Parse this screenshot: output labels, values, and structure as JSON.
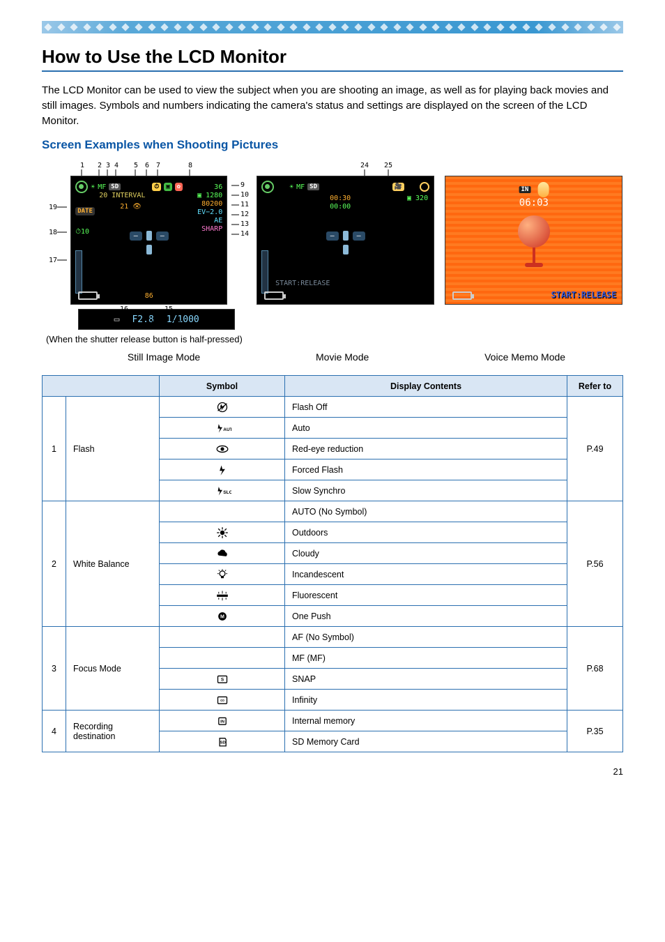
{
  "page_number": "21",
  "title": "How to Use the LCD Monitor",
  "intro": "The LCD Monitor can be used to view the subject when you are shooting an image, as well as for playing back movies and still images. Symbols and numbers indicating the camera's status and settings are displayed on the screen of the LCD Monitor.",
  "subheading": "Screen Examples when Shooting Pictures",
  "shutter_caption": "(When the shutter release button is half-pressed)",
  "mode_labels": {
    "still": "Still Image Mode",
    "movie": "Movie Mode",
    "voice": "Voice Memo Mode"
  },
  "still_lcd": {
    "remaining": "36",
    "interval_label": "INTERVAL",
    "interval_n": "20",
    "date_label": "DATE",
    "s10": "10",
    "right_stack": [
      "1280",
      "80200",
      "EV−2.0",
      "AE",
      "SHARP"
    ],
    "bottom_num": "86",
    "balloon21": "21",
    "aperture": "F2.8",
    "shutter": "1/1000"
  },
  "movie_lcd": {
    "time_top": "00:30",
    "time_bot": "00:00",
    "size": "320",
    "start": "START:RELEASE"
  },
  "voice_lcd": {
    "time": "06:03",
    "start": "START:RELEASE",
    "in": "IN"
  },
  "table": {
    "headers": {
      "symbol": "Symbol",
      "contents": "Display Contents",
      "refer": "Refer to"
    },
    "rows": [
      {
        "num": "1",
        "label": "Flash",
        "cells": [
          {
            "icon": "flash-off",
            "text": "Flash Off",
            "ref": "P.49"
          },
          {
            "icon": "flash-auto",
            "text": "Auto",
            "ref": ""
          },
          {
            "icon": "redeye",
            "text": "Red-eye reduction",
            "ref": ""
          },
          {
            "icon": "flash-forced",
            "text": "Forced Flash",
            "ref": ""
          },
          {
            "icon": "flash-slow",
            "text": "Slow Synchro",
            "ref": ""
          }
        ]
      },
      {
        "num": "2",
        "label": "White Balance",
        "cells": [
          {
            "icon": "none",
            "text": "AUTO (No Symbol)",
            "ref": "P.56"
          },
          {
            "icon": "wb-outdoors",
            "text": "Outdoors",
            "ref": ""
          },
          {
            "icon": "wb-cloudy",
            "text": "Cloudy",
            "ref": ""
          },
          {
            "icon": "wb-incand",
            "text": "Incandescent",
            "ref": ""
          },
          {
            "icon": "wb-fluor",
            "text": "Fluorescent",
            "ref": ""
          },
          {
            "icon": "wb-onepush",
            "text": "One Push",
            "ref": ""
          }
        ]
      },
      {
        "num": "3",
        "label": "Focus Mode",
        "cells": [
          {
            "icon": "none",
            "text": "AF (No Symbol)",
            "ref": "P.68"
          },
          {
            "icon": "none",
            "text": "MF (MF)",
            "ref": ""
          },
          {
            "icon": "focus-snap",
            "text": "SNAP",
            "ref": ""
          },
          {
            "icon": "focus-inf",
            "text": "Infinity",
            "ref": ""
          }
        ]
      },
      {
        "num": "4",
        "label": "Recording destination",
        "cells": [
          {
            "icon": "rec-in",
            "text": "Internal memory",
            "ref": "P.35"
          },
          {
            "icon": "rec-sd",
            "text": "SD Memory Card",
            "ref": ""
          }
        ]
      }
    ]
  }
}
